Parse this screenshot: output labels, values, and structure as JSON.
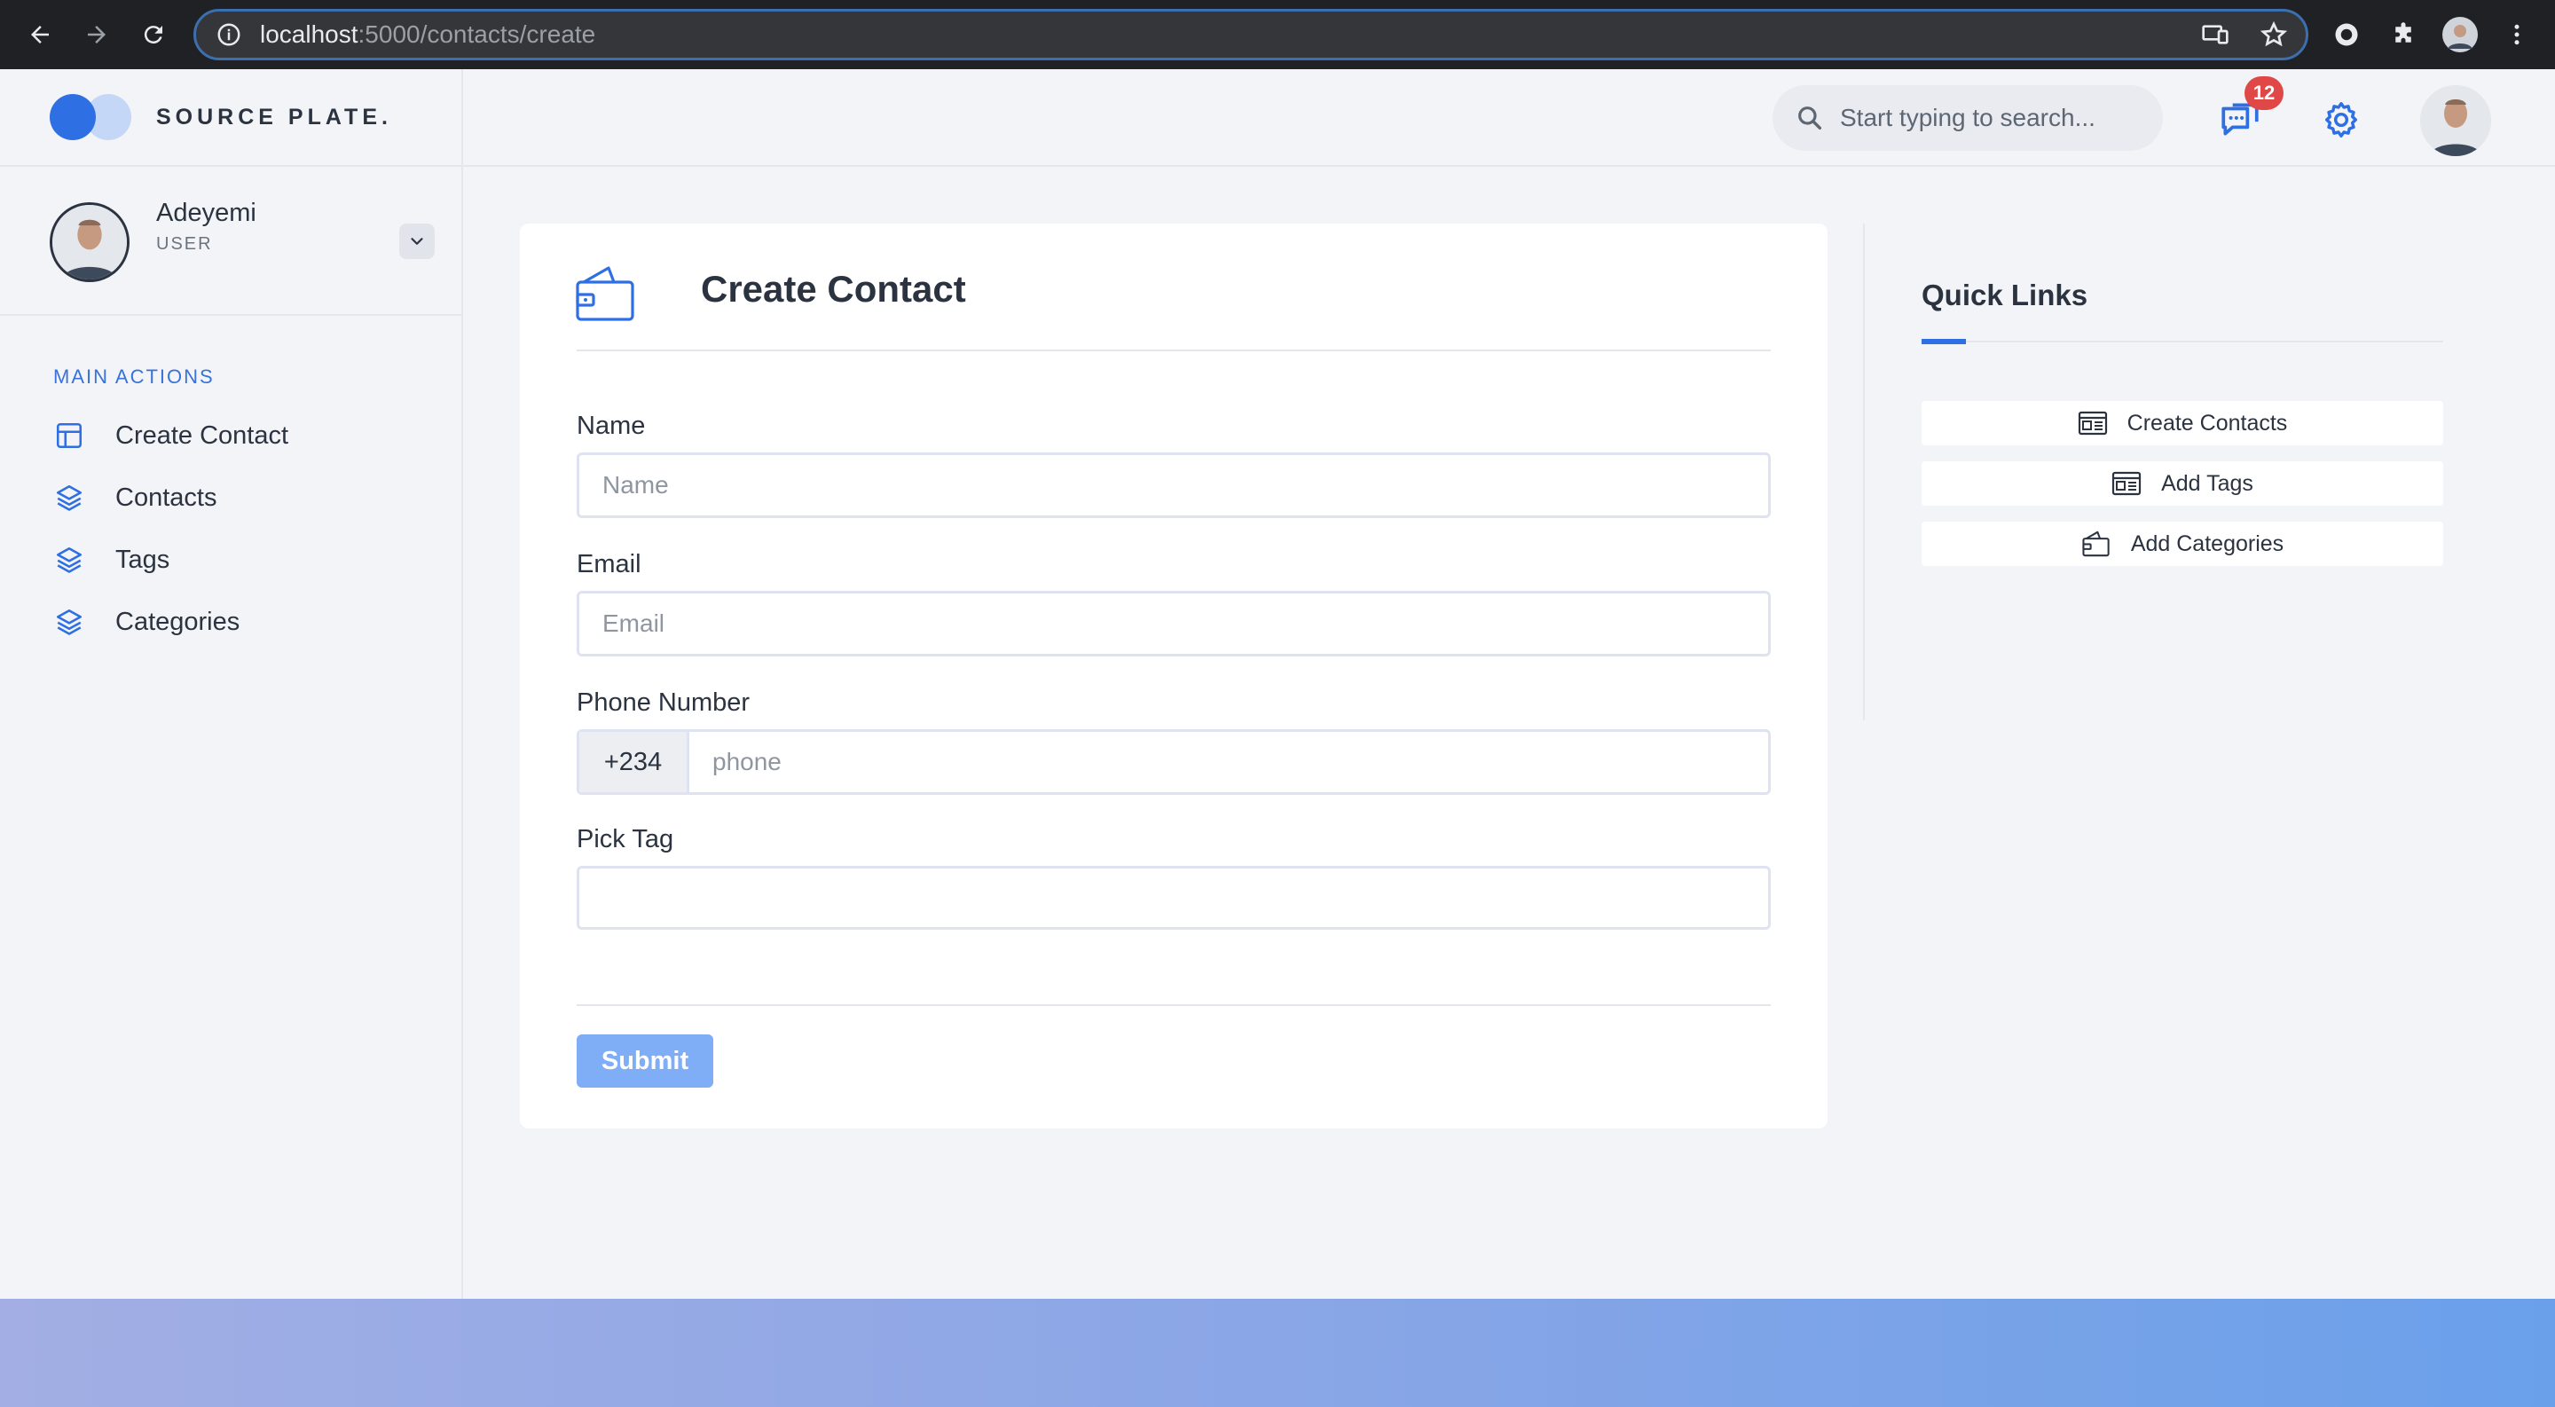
{
  "browser": {
    "url_host": "localhost",
    "url_path": ":5000/contacts/create"
  },
  "brand": {
    "name": "SOURCE PLATE."
  },
  "header": {
    "search_placeholder": "Start typing to search...",
    "notification_count": "12"
  },
  "sidebar": {
    "user": {
      "name": "Adeyemi",
      "role": "USER"
    },
    "section_label": "MAIN ACTIONS",
    "items": [
      {
        "label": "Create Contact",
        "icon": "layout-icon"
      },
      {
        "label": "Contacts",
        "icon": "layers-icon"
      },
      {
        "label": "Tags",
        "icon": "layers-icon"
      },
      {
        "label": "Categories",
        "icon": "layers-icon"
      }
    ]
  },
  "form": {
    "title": "Create Contact",
    "name_label": "Name",
    "name_placeholder": "Name",
    "email_label": "Email",
    "email_placeholder": "Email",
    "phone_label": "Phone Number",
    "phone_prefix": "+234",
    "phone_placeholder": "phone",
    "tag_label": "Pick Tag",
    "submit_label": "Submit"
  },
  "quick_links": {
    "title": "Quick Links",
    "items": [
      {
        "label": "Create Contacts",
        "icon": "newspaper-icon"
      },
      {
        "label": "Add Tags",
        "icon": "newspaper-icon"
      },
      {
        "label": "Add Categories",
        "icon": "wallet-icon"
      }
    ]
  },
  "colors": {
    "accent": "#2f6fe4",
    "badge": "#e04848",
    "submit": "#7fadf6"
  }
}
